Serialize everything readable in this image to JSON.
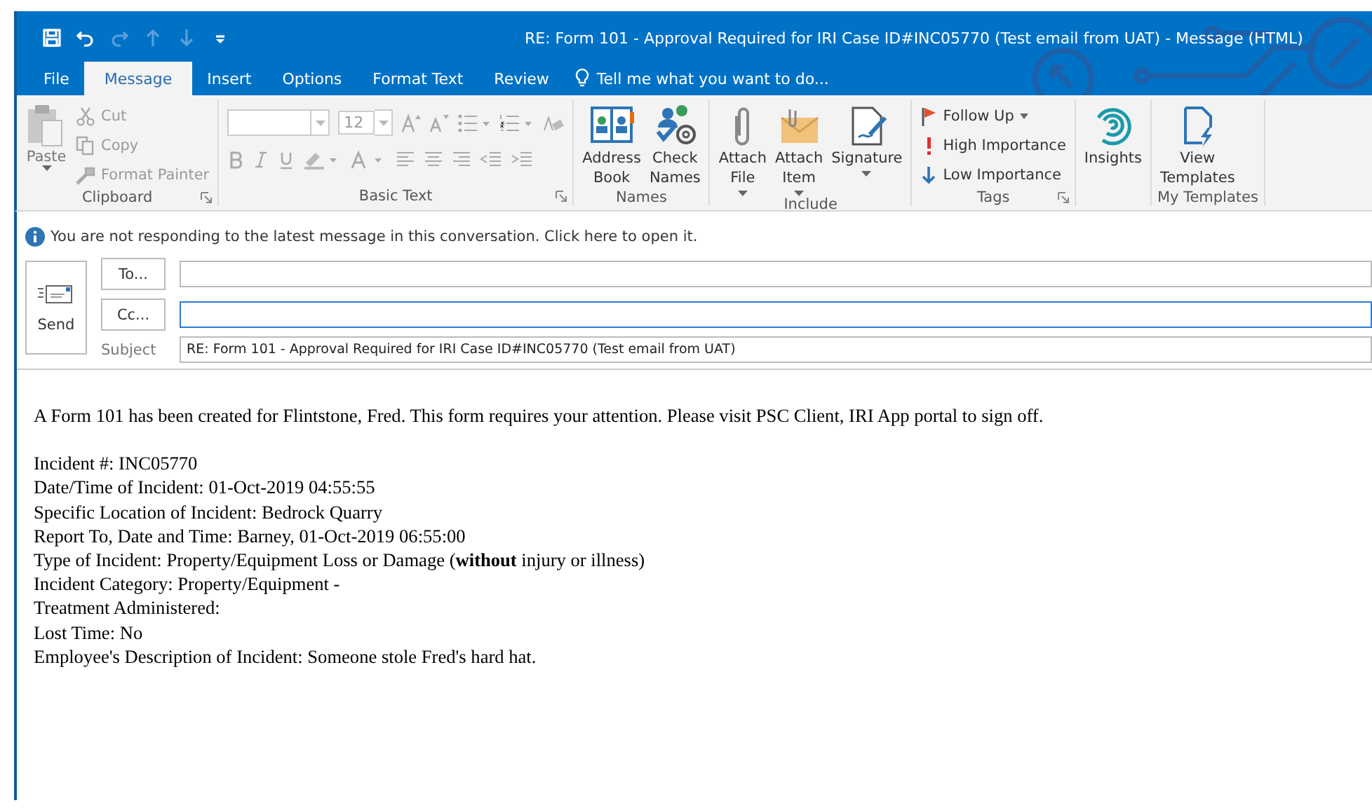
{
  "window": {
    "title": "RE: Form 101 - Approval Required for  IRI Case ID#INC05770 (Test email from UAT) - Message (HTML)"
  },
  "quick_access": [
    {
      "kind": "save",
      "disabled": false
    },
    {
      "kind": "undo",
      "disabled": false
    },
    {
      "kind": "redo",
      "disabled": true
    },
    {
      "kind": "up",
      "disabled": true
    },
    {
      "kind": "down",
      "disabled": true
    },
    {
      "kind": "customize",
      "disabled": false
    }
  ],
  "tabs": [
    {
      "label": "File",
      "selected": false
    },
    {
      "label": "Message",
      "selected": true
    },
    {
      "label": "Insert",
      "selected": false
    },
    {
      "label": "Options",
      "selected": false
    },
    {
      "label": "Format Text",
      "selected": false
    },
    {
      "label": "Review",
      "selected": false
    }
  ],
  "tell_me": "Tell me what you want to do...",
  "ribbon": [
    {
      "kind": "clipboard",
      "label": "Clipboard",
      "launcher": true,
      "paste": {
        "label": "Paste",
        "disabled": true
      },
      "items": [
        {
          "kind": "cut",
          "label": "Cut",
          "disabled": true
        },
        {
          "kind": "copy",
          "label": "Copy",
          "disabled": true
        },
        {
          "kind": "painter",
          "label": "Format Painter",
          "disabled": true
        }
      ]
    },
    {
      "kind": "basic_text",
      "label": "Basic Text",
      "launcher": true,
      "font_size": "12"
    },
    {
      "kind": "large",
      "label": "Names",
      "buttons": [
        {
          "kind": "book",
          "label": "Address Book",
          "dropdown": false
        },
        {
          "kind": "check",
          "label": "Check Names",
          "dropdown": false
        }
      ]
    },
    {
      "kind": "large",
      "label": "Include",
      "buttons": [
        {
          "kind": "clip",
          "label": "Attach File",
          "dropdown": true
        },
        {
          "kind": "envelope",
          "label": "Attach Item",
          "dropdown": true
        },
        {
          "kind": "signature",
          "label": "Signature",
          "dropdown": true
        }
      ]
    },
    {
      "kind": "tags",
      "label": "Tags",
      "launcher": true,
      "items": [
        {
          "kind": "flag",
          "label": "Follow Up",
          "dropdown": true
        },
        {
          "kind": "high",
          "label": "High Importance",
          "dropdown": false
        },
        {
          "kind": "low",
          "label": "Low Importance",
          "dropdown": false
        }
      ]
    },
    {
      "kind": "large",
      "buttons": [
        {
          "kind": "insights",
          "label": "Insights",
          "dropdown": false
        }
      ]
    },
    {
      "kind": "large",
      "label": "My Templates",
      "buttons": [
        {
          "kind": "templates",
          "label": "View Templates",
          "dropdown": false
        }
      ]
    }
  ],
  "notice": "You are not responding to the latest message in this conversation. Click here to open it.",
  "compose": {
    "send": "Send",
    "to_button": "To...",
    "cc_button": "Cc...",
    "to_focused": false,
    "cc_focused": true,
    "subject_label": "Subject",
    "subject": "RE: Form 101 - Approval Required for  IRI Case ID#INC05770 (Test email from UAT)"
  },
  "body": {
    "intro": "A Form 101 has been created for Flintstone, Fred. This form requires your attention. Please visit PSC Client, IRI App portal to sign off.",
    "lines": [
      "Incident #: INC05770",
      "Date/Time of Incident: 01-Oct-2019 04:55:55",
      "Specific Location of Incident: Bedrock Quarry",
      "Report To, Date and Time: Barney, 01-Oct-2019 06:55:00",
      "Type of Incident: Property/Equipment Loss or Damage (**without** injury or illness)",
      "Incident Category: Property/Equipment -",
      "Treatment Administered:",
      "Lost Time: No",
      "Employee's Description of Incident: Someone stole Fred's hard hat."
    ]
  }
}
